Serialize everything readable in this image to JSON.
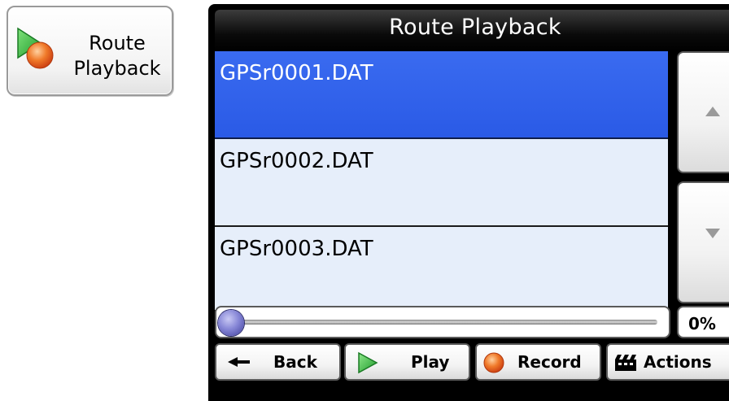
{
  "shortcut": {
    "label_line1": "Route",
    "label_line2": "Playback"
  },
  "window": {
    "title": "Route Playback"
  },
  "files": [
    {
      "name": "GPSr0001.DAT",
      "selected": true
    },
    {
      "name": "GPSr0002.DAT",
      "selected": false
    },
    {
      "name": "GPSr0003.DAT",
      "selected": false
    }
  ],
  "scroll": {
    "up_icon": "triangle-up-icon",
    "down_icon": "triangle-down-icon"
  },
  "progress": {
    "value": 0,
    "label": "0%"
  },
  "toolbar": {
    "back_label": "Back",
    "play_label": "Play",
    "record_label": "Record",
    "actions_label": "Actions"
  },
  "colors": {
    "selected_row": "#2a5ae6",
    "list_background": "#e6eefa",
    "title_bar": "#000000",
    "play_green": "#22b040",
    "record_orange": "#e8501c",
    "knob_blue": "#6a6ad0"
  }
}
